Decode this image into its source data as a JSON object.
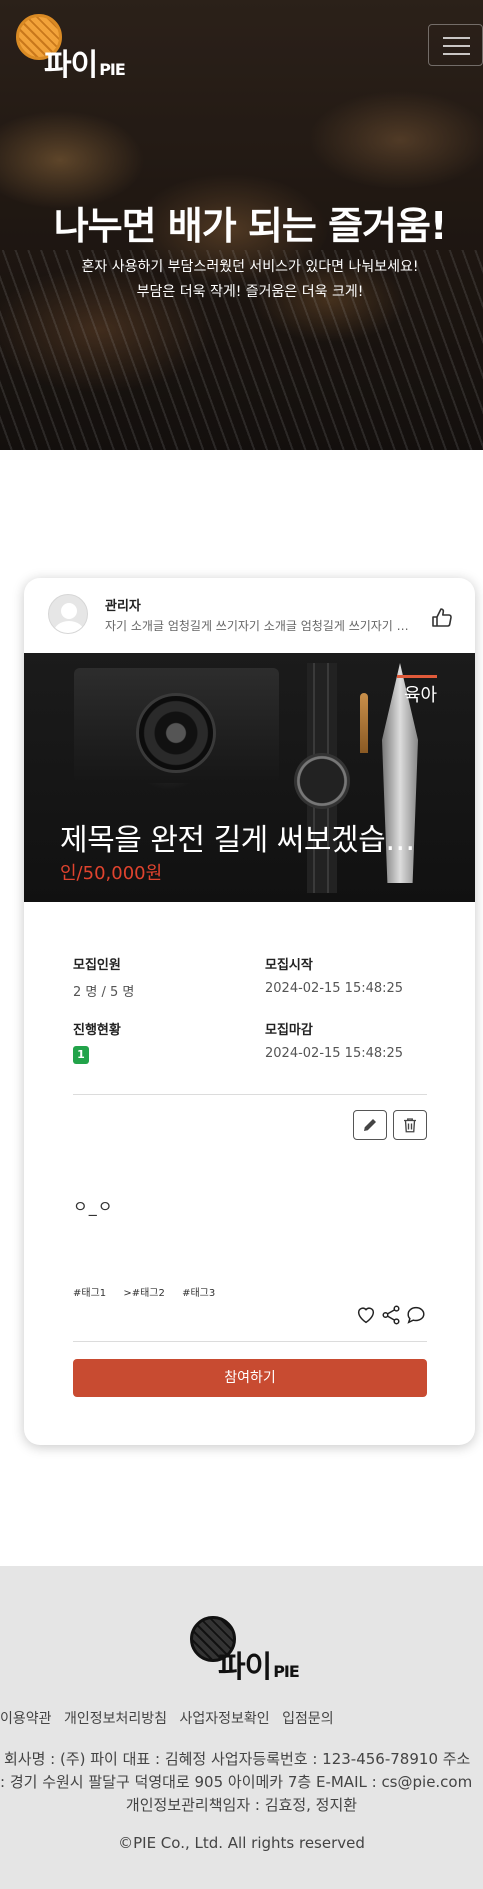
{
  "header": {
    "logo_text": "파이",
    "logo_suffix": "PIE",
    "hero_title": "나누면 배가 되는 즐거움!",
    "hero_sub1": "혼자 사용하기 부담스러웠던 서비스가 있다면 나눠보세요!",
    "hero_sub2": "부담은 더욱 작게! 즐거움은 더욱 크게!"
  },
  "post": {
    "author": "관리자",
    "intro": "자기 소개글 엄청길게 쓰기자기 소개글 엄청길게 쓰기자기 소개글 엄청길게 쓰기",
    "category": "육아",
    "title": "제목을 완전 길게 써보겠습니다",
    "price": "인/50,000원",
    "labels": {
      "members": "모집인원",
      "start": "모집시작",
      "status": "진행현황",
      "end": "모집마감"
    },
    "members": "2 명 / 5 명",
    "start": "2024-02-15 15:48:25",
    "status_badge": "1",
    "end": "2024-02-15 15:48:25",
    "body": "ㅇ_ㅇ",
    "tags": [
      "#태그1",
      ">#태그2",
      "#태그3"
    ],
    "join_label": "참여하기",
    "icons": {
      "like": "thumbs-up-icon",
      "edit": "pencil-icon",
      "delete": "trash-icon",
      "heart": "heart-icon",
      "share": "share-icon",
      "comment": "comment-icon"
    }
  },
  "footer": {
    "logo_text": "파이",
    "logo_suffix": "PIE",
    "links": [
      "이용약관",
      "개인정보처리방침",
      "사업자정보확인",
      "입점문의"
    ],
    "line1": "회사명 : (주) 파이 대표 : 김혜정 사업자등록번호 : 123-456-78910 주소",
    "line2": ": 경기 수원시 팔달구 덕영대로 905 아이메카 7층 E-MAIL : cs@pie.com",
    "line3": "개인정보관리책임자 : 김효정, 정지환",
    "copyright": "©PIE Co., Ltd. All rights reserved"
  },
  "colors": {
    "accent": "#c84b31",
    "price": "#e0432e",
    "badge": "#22a34a",
    "footer_bg": "#e5e5e5"
  }
}
